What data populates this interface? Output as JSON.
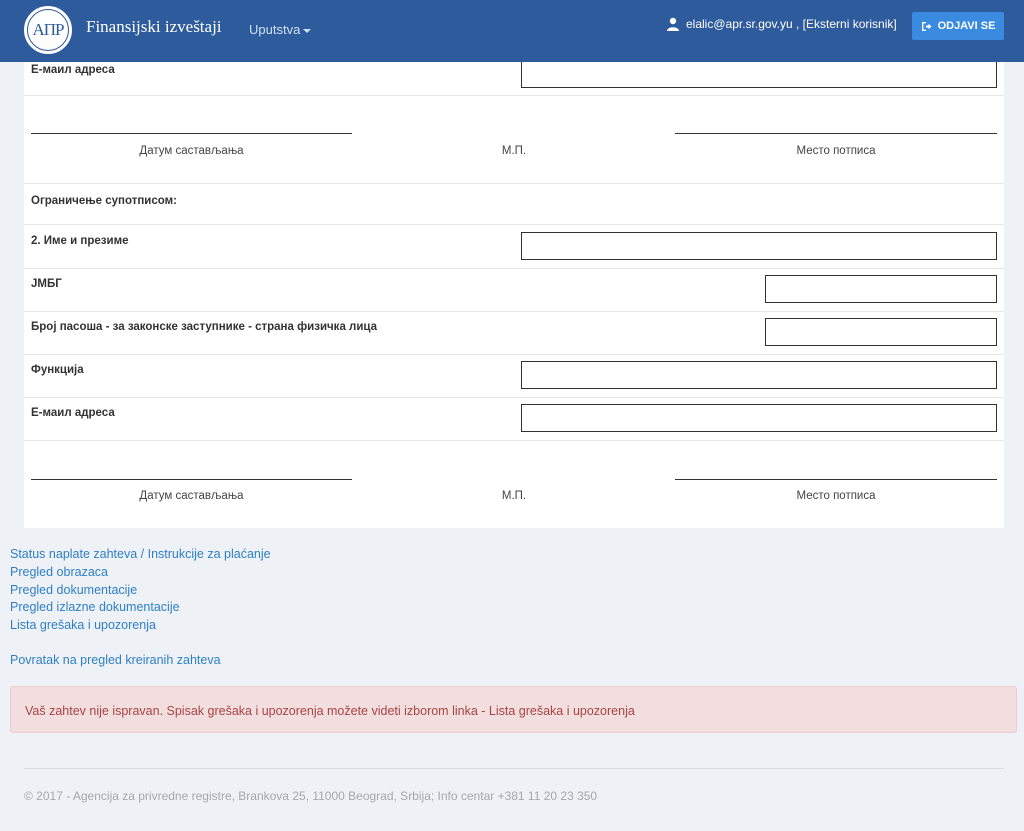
{
  "navbar": {
    "logo_text": "АПР",
    "brand": "Finansijski izveštaji",
    "menu_label": "Uputstva",
    "user_label": "elalic@apr.sr.gov.yu , [Eksterni korisnik]",
    "logout_label": "ODJAVI SE",
    "color": "#2e5b9c"
  },
  "form": {
    "email_label_top": "Е-маил адреса",
    "sig1": {
      "date_label": "Датум састављања",
      "stamp_label": "М.П.",
      "place_label": "Место потписа"
    },
    "restriction_label": "Ограничење супотписом:",
    "name_label": "2. Име и презиме",
    "jmbg_label": "ЈМБГ",
    "passport_label": "Број пасоша - за законске заступнике - страна физичка лица",
    "function_label": "Функција",
    "email_label": "Е-маил адреса",
    "sig2": {
      "date_label": "Датум састављања",
      "stamp_label": "М.П.",
      "place_label": "Место потписа"
    }
  },
  "links": {
    "items": [
      "Status naplate zahteva / Instrukcije za plaćanje",
      "Pregled obrazaca",
      "Pregled dokumentacije",
      "Pregled izlazne dokumentacije",
      "Lista grešaka i upozorenja"
    ],
    "back": "Povratak na pregled kreiranih zahteva"
  },
  "alert": {
    "message": "Vaš zahtev nije ispravan. Spisak grešaka i upozorenja možete videti izborom linka - Lista grešaka i upozorenja"
  },
  "footer": {
    "text": "© 2017 - Agencija za privredne registre, Brankova 25, 11000 Beograd, Srbija; Info centar +381 11 20 23 350"
  }
}
